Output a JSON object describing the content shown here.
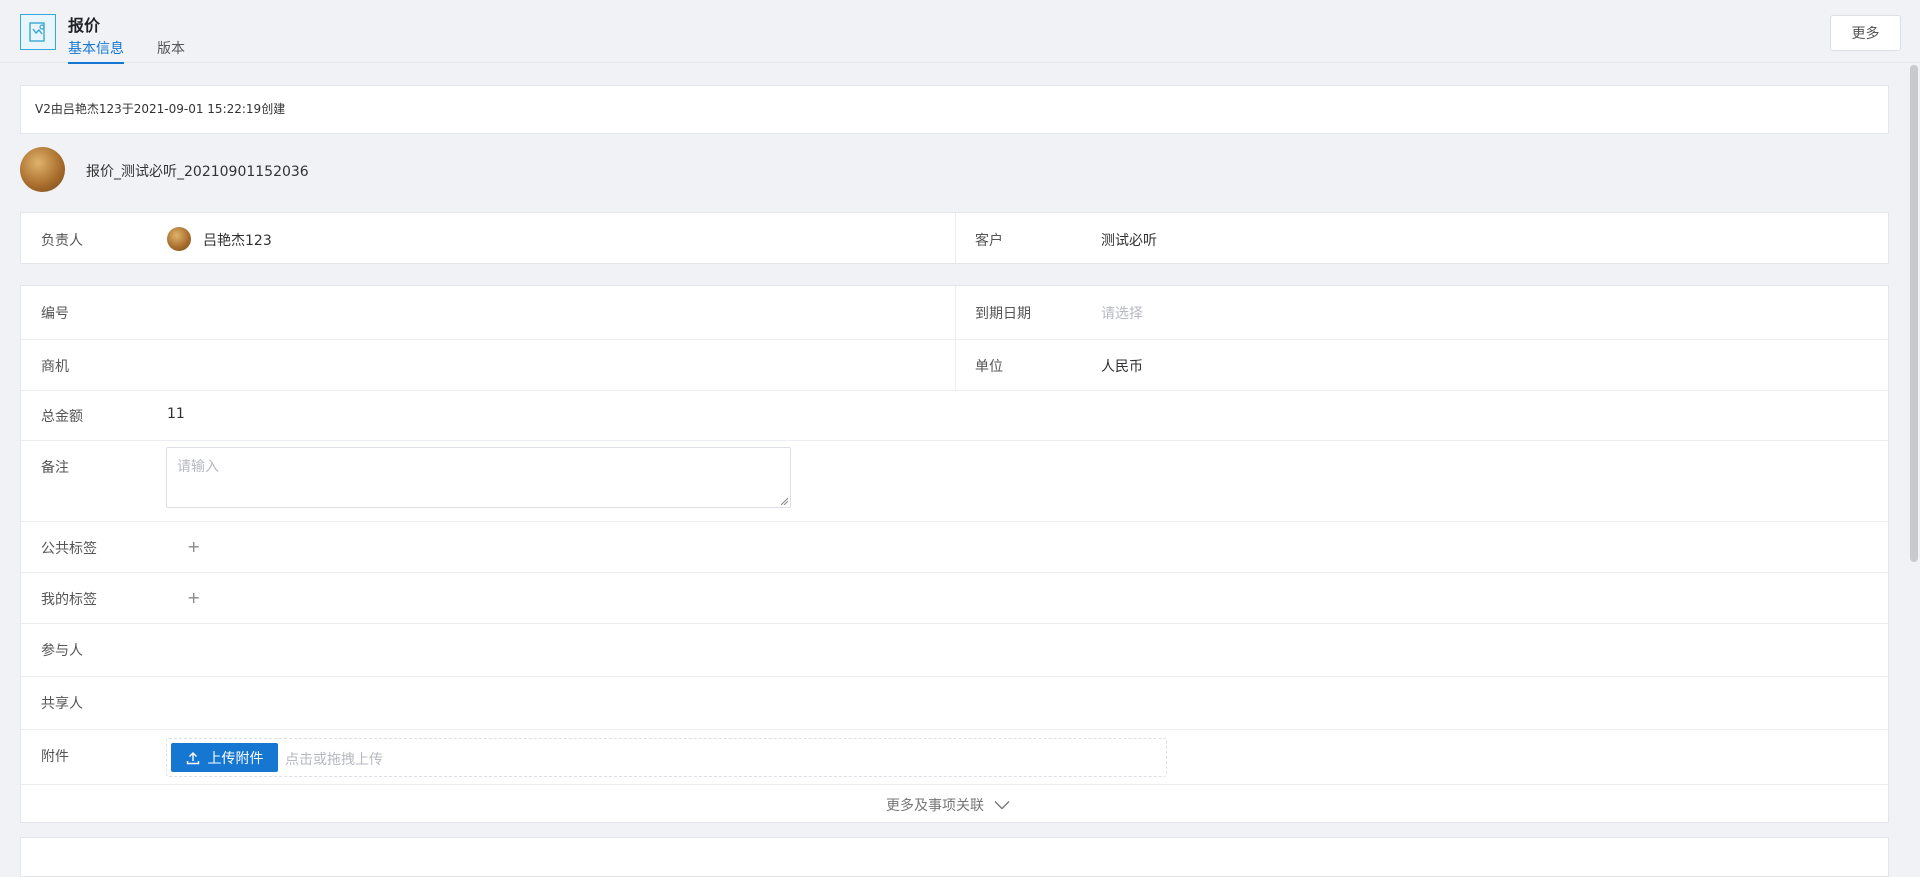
{
  "header": {
    "title": "报价",
    "tabs": [
      {
        "label": "基本信息",
        "active": true
      },
      {
        "label": "版本",
        "active": false
      }
    ],
    "more_label": "更多"
  },
  "version_info": "V2由吕艳杰123于2021-09-01 15:22:19创建",
  "record": {
    "name": "报价_测试必听_20210901152036"
  },
  "owner": {
    "label": "负责人",
    "value": "吕艳杰123"
  },
  "customer": {
    "label": "客户",
    "value": "测试必听"
  },
  "fields": {
    "number": {
      "label": "编号",
      "value": ""
    },
    "due_date": {
      "label": "到期日期",
      "placeholder": "请选择"
    },
    "opportunity": {
      "label": "商机",
      "value": ""
    },
    "unit": {
      "label": "单位",
      "value": "人民币"
    },
    "total": {
      "label": "总金额",
      "value": "11"
    },
    "remark": {
      "label": "备注",
      "placeholder": "请输入"
    },
    "public_tags": {
      "label": "公共标签",
      "add": "+"
    },
    "my_tags": {
      "label": "我的标签",
      "add": "+"
    },
    "participants": {
      "label": "参与人"
    },
    "sharers": {
      "label": "共享人"
    },
    "attachments": {
      "label": "附件",
      "upload_label": "上传附件",
      "hint": "点击或拖拽上传"
    }
  },
  "expand_label": "更多及事项关联",
  "colors": {
    "accent": "#1677d2",
    "background": "#f1f2f5",
    "border": "#e3e5ea"
  }
}
